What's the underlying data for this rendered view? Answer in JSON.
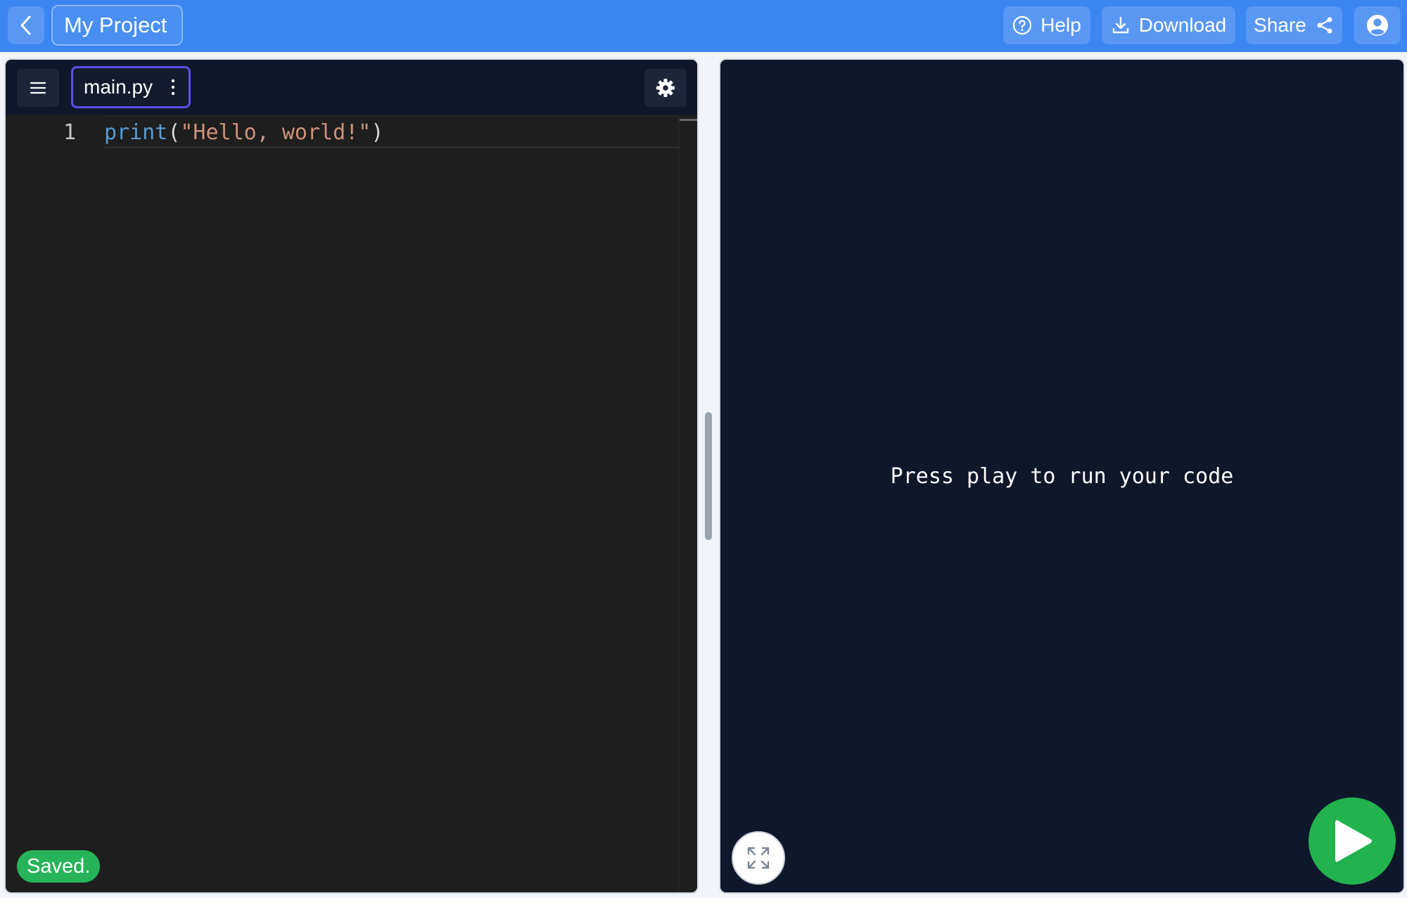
{
  "header": {
    "project_title": "My Project",
    "help_label": "Help",
    "download_label": "Download",
    "share_label": "Share",
    "accent_color": "#3b86f0"
  },
  "editor": {
    "tab_label": "main.py",
    "lines": [
      {
        "number": "1",
        "tokens": {
          "fn": "print",
          "open": "(",
          "str": "\"Hello, world!\"",
          "close": ")"
        }
      }
    ],
    "status": "Saved."
  },
  "output": {
    "message": "Press play to run your code"
  },
  "icons": {
    "back": "chevron-left-icon",
    "help": "question-circle-icon",
    "download": "download-icon",
    "share": "share-icon",
    "account": "user-circle-icon",
    "menu": "hamburger-menu-icon",
    "tab_options": "vertical-dots-icon",
    "settings": "gear-icon",
    "fullscreen": "expand-icon",
    "run": "play-icon"
  }
}
